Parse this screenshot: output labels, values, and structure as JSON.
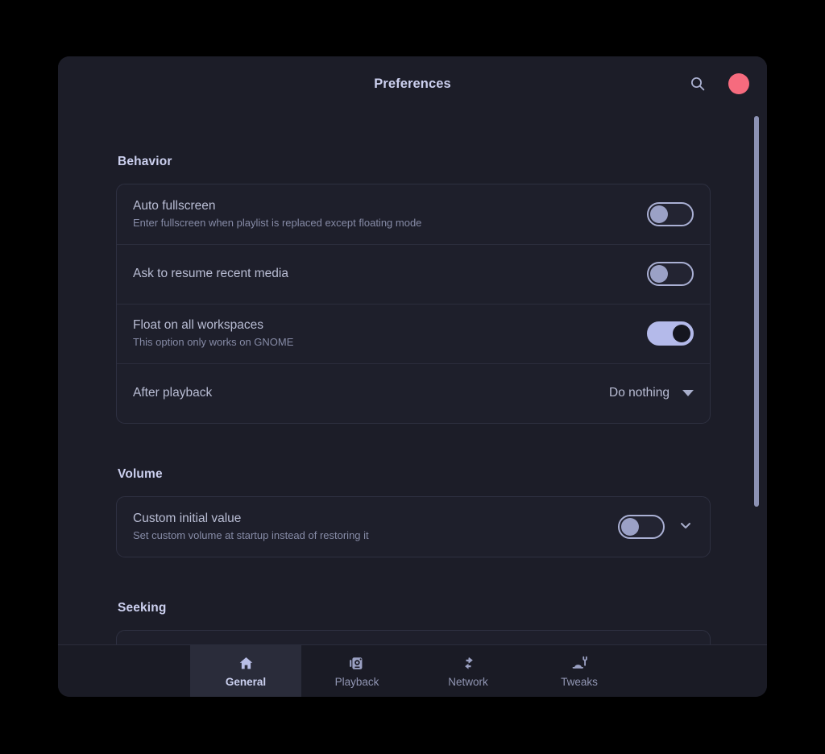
{
  "window": {
    "title": "Preferences",
    "accent_color": "#b4baea",
    "close_color": "#f66b7e",
    "background": "#1c1d28"
  },
  "header": {
    "title": "Preferences",
    "search_icon": "search-icon",
    "close_icon": "close-circle-icon"
  },
  "sections": [
    {
      "title": "Behavior",
      "rows": [
        {
          "title": "Auto fullscreen",
          "subtitle": "Enter fullscreen when playlist is replaced except floating mode",
          "control": "toggle",
          "state": "off"
        },
        {
          "title": "Ask to resume recent media",
          "subtitle": "",
          "control": "toggle",
          "state": "off"
        },
        {
          "title": "Float on all workspaces",
          "subtitle": "This option only works on GNOME",
          "control": "toggle",
          "state": "on"
        },
        {
          "title": "After playback",
          "subtitle": "",
          "control": "dropdown",
          "value": "Do nothing"
        }
      ]
    },
    {
      "title": "Volume",
      "rows": [
        {
          "title": "Custom initial value",
          "subtitle": "Set custom volume at startup instead of restoring it",
          "control": "toggle-expander",
          "state": "off"
        }
      ]
    },
    {
      "title": "Seeking",
      "rows": []
    }
  ],
  "bottom_nav": {
    "tabs": [
      {
        "label": "General",
        "icon": "home-icon",
        "active": true
      },
      {
        "label": "Playback",
        "icon": "media-icon",
        "active": false
      },
      {
        "label": "Network",
        "icon": "network-icon",
        "active": false
      },
      {
        "label": "Tweaks",
        "icon": "wrench-icon",
        "active": false
      }
    ]
  },
  "scrollbar": {
    "visible": true,
    "position": "right"
  }
}
